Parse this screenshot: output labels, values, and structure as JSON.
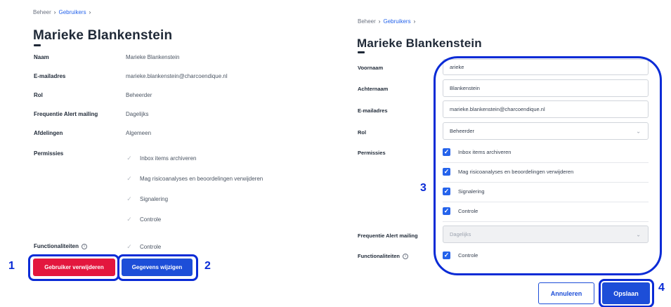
{
  "left": {
    "breadcrumb": {
      "root": "Beheer",
      "current": "Gebruikers"
    },
    "title": "Marieke Blankenstein",
    "fields": [
      {
        "label": "Naam",
        "value": "Marieke Blankenstein"
      },
      {
        "label": "E-mailadres",
        "value": "marieke.blankenstein@charcoendique.nl"
      },
      {
        "label": "Rol",
        "value": "Beheerder"
      },
      {
        "label": "Frequentie Alert mailing",
        "value": "Dagelijks"
      },
      {
        "label": "Afdelingen",
        "value": "Algemeen"
      }
    ],
    "permissions_label": "Permissies",
    "permissions": [
      "Inbox items archiveren",
      "Mag risicoanalyses en beoordelingen verwijderen",
      "Signalering",
      "Controle"
    ],
    "functionalities_label": "Functionaliteiten",
    "functionalities": [
      "Controle"
    ],
    "delete_button": "Gebruiker verwijderen",
    "edit_button": "Gegevens wijzigen"
  },
  "right": {
    "breadcrumb": {
      "root": "Beheer",
      "current": "Gebruikers"
    },
    "title": "Marieke Blankenstein",
    "first_name_label": "Voornaam",
    "first_name_value": "arieke",
    "last_name_label": "Achternaam",
    "last_name_value": "Blankenstein",
    "email_label": "E-mailadres",
    "email_value": "marieke.blankenstein@charcoendique.nl",
    "role_label": "Rol",
    "role_value": "Beheerder",
    "permissions_label": "Permissies",
    "permissions": [
      "Inbox items archiveren",
      "Mag risicoanalyses en beoordelingen verwijderen",
      "Signalering",
      "Controle"
    ],
    "frequency_label": "Frequentie Alert mailing",
    "frequency_value": "Dagelijks",
    "functionalities_label": "Functionaliteiten",
    "functionalities": [
      "Controle"
    ],
    "cancel_button": "Annuleren",
    "save_button": "Opslaan"
  },
  "annotations": [
    "1",
    "2",
    "3",
    "4"
  ],
  "colors": {
    "accent": "#1d4ed8",
    "danger": "#e3173e",
    "highlight": "#0a2bd6"
  },
  "icons": {
    "separator": "chevron-right-icon",
    "check": "check-icon",
    "info": "info-icon",
    "dropdown": "chevron-down-icon"
  }
}
